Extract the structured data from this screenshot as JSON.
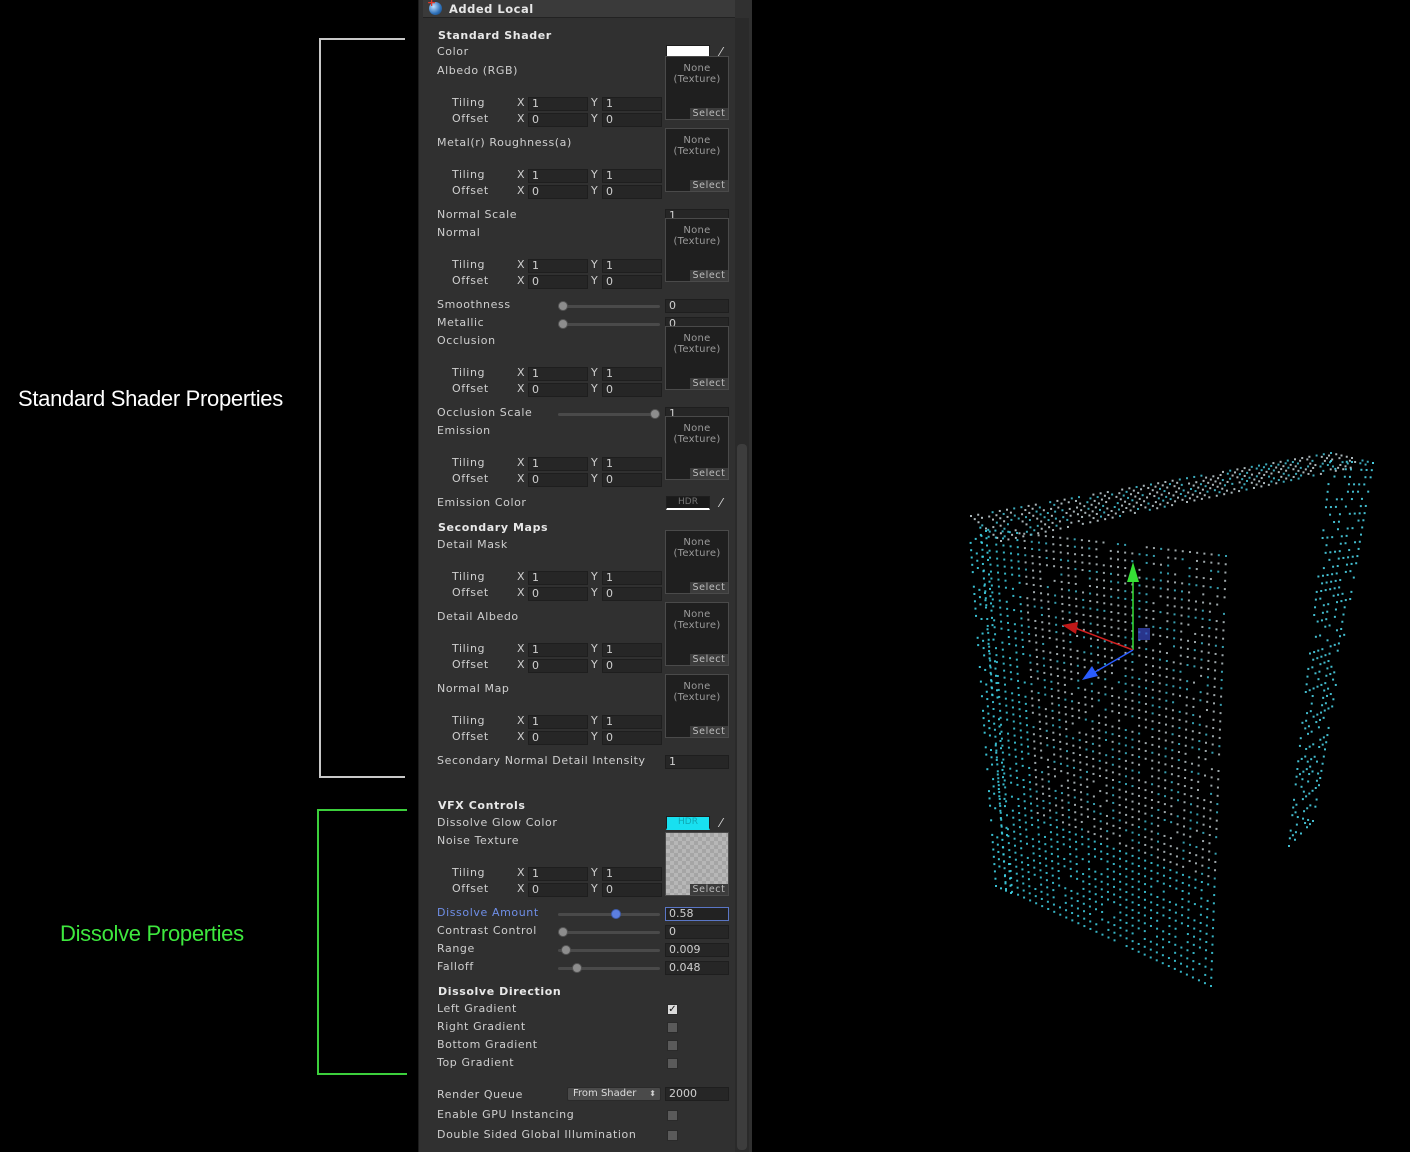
{
  "annotations": {
    "standard_label": "Standard Shader Properties",
    "dissolve_label": "Dissolve Properties"
  },
  "colors": {
    "annotation_white": "#ffffff",
    "annotation_green": "#3ee83e",
    "dissolve_glow": "#18e0f0",
    "active_blue": "#6f8fe8"
  },
  "header": {
    "title": "Added Local",
    "icon": "material-sphere-icon"
  },
  "texture": {
    "none_line1": "None",
    "none_line2": "(Texture)",
    "select": "Select"
  },
  "axes": {
    "x": "X",
    "y": "Y"
  },
  "common": {
    "tiling": "Tiling",
    "offset": "Offset",
    "hdr": "HDR"
  },
  "standard": {
    "section": "Standard Shader",
    "color": "Color",
    "albedo": {
      "label": "Albedo (RGB)",
      "tx": "1",
      "ty": "1",
      "ox": "0",
      "oy": "0"
    },
    "metal": {
      "label": "Metal(r) Roughness(a)",
      "tx": "1",
      "ty": "1",
      "ox": "0",
      "oy": "0"
    },
    "normal_scale": {
      "label": "Normal Scale",
      "value": "1"
    },
    "normal": {
      "label": "Normal",
      "tx": "1",
      "ty": "1",
      "ox": "0",
      "oy": "0"
    },
    "smoothness": {
      "label": "Smoothness",
      "value": "0",
      "level": 0
    },
    "metallic": {
      "label": "Metallic",
      "value": "0",
      "level": 0
    },
    "occlusion": {
      "label": "Occlusion",
      "tx": "1",
      "ty": "1",
      "ox": "0",
      "oy": "0"
    },
    "occlusion_scale": {
      "label": "Occlusion Scale",
      "value": "1",
      "level": 1
    },
    "emission": {
      "label": "Emission",
      "tx": "1",
      "ty": "1",
      "ox": "0",
      "oy": "0"
    },
    "emission_color": "Emission Color"
  },
  "secondary": {
    "section": "Secondary Maps",
    "detail_mask": {
      "label": "Detail Mask",
      "tx": "1",
      "ty": "1",
      "ox": "0",
      "oy": "0"
    },
    "detail_albedo": {
      "label": "Detail Albedo",
      "tx": "1",
      "ty": "1",
      "ox": "0",
      "oy": "0"
    },
    "normal_map": {
      "label": "Normal Map",
      "tx": "1",
      "ty": "1",
      "ox": "0",
      "oy": "0"
    },
    "intensity": {
      "label": "Secondary Normal Detail Intensity",
      "value": "1"
    }
  },
  "vfx": {
    "section": "VFX Controls",
    "glow_color": "Dissolve Glow Color",
    "noise": {
      "label": "Noise Texture",
      "tx": "1",
      "ty": "1",
      "ox": "0",
      "oy": "0"
    },
    "dissolve_amount": {
      "label": "Dissolve Amount",
      "value": "0.58",
      "level": 0.58
    },
    "contrast": {
      "label": "Contrast Control",
      "value": "0",
      "level": 0
    },
    "range": {
      "label": "Range",
      "value": "0.009",
      "level": 0.03
    },
    "falloff": {
      "label": "Falloff",
      "value": "0.048",
      "level": 0.15
    }
  },
  "direction": {
    "section": "Dissolve Direction",
    "left": {
      "label": "Left Gradient",
      "checked": true
    },
    "right": {
      "label": "Right Gradient",
      "checked": false
    },
    "bottom": {
      "label": "Bottom Gradient",
      "checked": false
    },
    "top": {
      "label": "Top Gradient",
      "checked": false
    }
  },
  "render": {
    "queue_label": "Render Queue",
    "queue_mode": "From Shader",
    "queue_value": "2000",
    "gpu_instancing": "Enable GPU Instancing",
    "double_sided_gi": "Double Sided Global Illumination"
  }
}
